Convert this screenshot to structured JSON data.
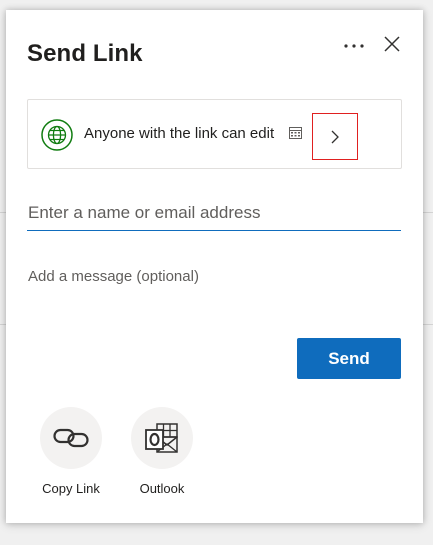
{
  "dialog": {
    "title": "Send Link",
    "permission": {
      "text": "Anyone with the link can edit",
      "icon": "globe-icon",
      "accent": "#107c10"
    },
    "recipients": {
      "placeholder": "Enter a name or email address"
    },
    "message": {
      "placeholder": "Add a message (optional)"
    },
    "send_label": "Send",
    "share_options": [
      {
        "label": "Copy Link",
        "icon": "link-icon"
      },
      {
        "label": "Outlook",
        "icon": "outlook-icon"
      }
    ]
  },
  "colors": {
    "primary": "#0f6cbd",
    "highlight_border": "#e02020"
  }
}
